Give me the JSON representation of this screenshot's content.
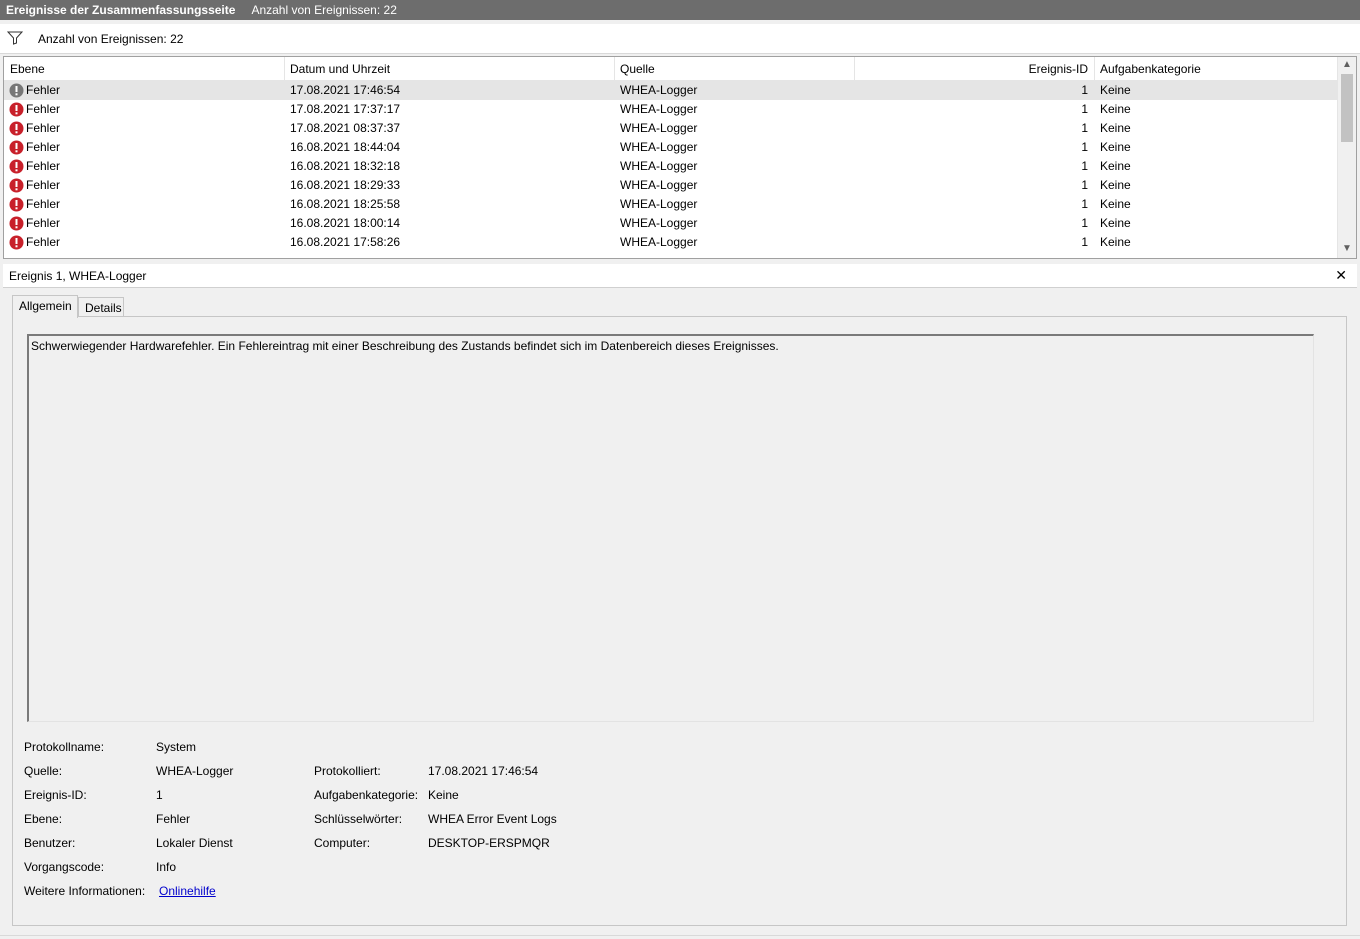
{
  "title_bar": {
    "title": "Ereignisse der Zusammenfassungsseite",
    "count": "Anzahl von Ereignissen: 22"
  },
  "filter": {
    "icon": "funnel-icon",
    "count": "Anzahl von Ereignissen: 22"
  },
  "columns": {
    "ebene": "Ebene",
    "datum": "Datum und Uhrzeit",
    "quelle": "Quelle",
    "id": "Ereignis-ID",
    "kat": "Aufgabenkategorie"
  },
  "rows": [
    {
      "ebene": "Fehler",
      "datum": "17.08.2021 17:46:54",
      "quelle": "WHEA-Logger",
      "id": "1",
      "kat": "Keine"
    },
    {
      "ebene": "Fehler",
      "datum": "17.08.2021 17:37:17",
      "quelle": "WHEA-Logger",
      "id": "1",
      "kat": "Keine"
    },
    {
      "ebene": "Fehler",
      "datum": "17.08.2021 08:37:37",
      "quelle": "WHEA-Logger",
      "id": "1",
      "kat": "Keine"
    },
    {
      "ebene": "Fehler",
      "datum": "16.08.2021 18:44:04",
      "quelle": "WHEA-Logger",
      "id": "1",
      "kat": "Keine"
    },
    {
      "ebene": "Fehler",
      "datum": "16.08.2021 18:32:18",
      "quelle": "WHEA-Logger",
      "id": "1",
      "kat": "Keine"
    },
    {
      "ebene": "Fehler",
      "datum": "16.08.2021 18:29:33",
      "quelle": "WHEA-Logger",
      "id": "1",
      "kat": "Keine"
    },
    {
      "ebene": "Fehler",
      "datum": "16.08.2021 18:25:58",
      "quelle": "WHEA-Logger",
      "id": "1",
      "kat": "Keine"
    },
    {
      "ebene": "Fehler",
      "datum": "16.08.2021 18:00:14",
      "quelle": "WHEA-Logger",
      "id": "1",
      "kat": "Keine"
    },
    {
      "ebene": "Fehler",
      "datum": "16.08.2021 17:58:26",
      "quelle": "WHEA-Logger",
      "id": "1",
      "kat": "Keine"
    }
  ],
  "detail": {
    "title": "Ereignis 1, WHEA-Logger",
    "close": "✕",
    "tabs": {
      "general": "Allgemein",
      "details": "Details"
    },
    "description": "Schwerwiegender Hardwarefehler. Ein Fehlereintrag mit einer Beschreibung des Zustands befindet sich im Datenbereich dieses Ereignisses.",
    "labels": {
      "protokollname": "Protokollname:",
      "quelle": "Quelle:",
      "ereignis_id": "Ereignis-ID:",
      "ebene": "Ebene:",
      "benutzer": "Benutzer:",
      "vorgangscode": "Vorgangscode:",
      "weitere": "Weitere Informationen:",
      "protokolliert": "Protokolliert:",
      "aufgabenkategorie": "Aufgabenkategorie:",
      "schluesselwoerter": "Schlüsselwörter:",
      "computer": "Computer:"
    },
    "values": {
      "protokollname": "System",
      "quelle": "WHEA-Logger",
      "ereignis_id": "1",
      "ebene": "Fehler",
      "benutzer": "Lokaler Dienst",
      "vorgangscode": "Info",
      "weitere": "Onlinehilfe",
      "protokolliert": "17.08.2021 17:46:54",
      "aufgabenkategorie": "Keine",
      "schluesselwoerter": "WHEA Error Event Logs",
      "computer": "DESKTOP-ERSPMQR"
    }
  },
  "colors": {
    "error_red": "#c8202a",
    "link": "#0000cc",
    "title_bg": "#6d6d6d"
  }
}
